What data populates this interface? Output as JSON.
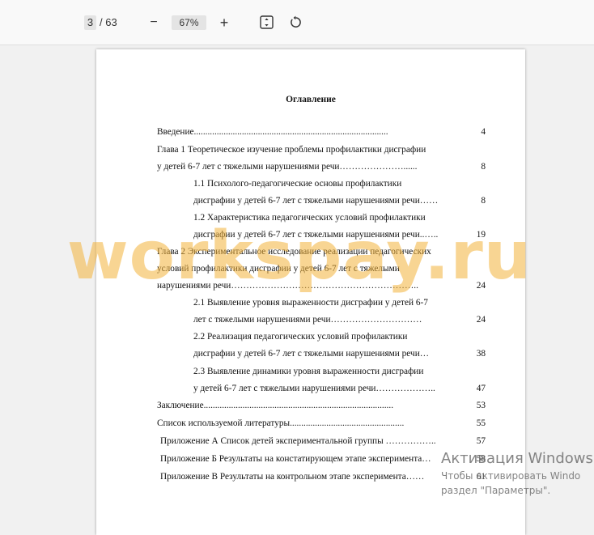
{
  "toolbar": {
    "current_page": "3",
    "total_pages": "/ 63",
    "zoom_out_label": "−",
    "zoom_level": "67%",
    "zoom_in_label": "+",
    "fit_icon": "fit-page-icon",
    "rotate_icon": "rotate-icon"
  },
  "document": {
    "title": "Оглавление",
    "toc": [
      {
        "text": "Введение.....................................................................................",
        "page": "4"
      },
      {
        "text": "Глава 1 Теоретическое изучение проблемы профилактики дисграфии",
        "page": ""
      },
      {
        "text": "у детей 6-7 лет с тяжелыми нарушениями речи…………………......",
        "page": "8"
      },
      {
        "text": "1.1 Психолого-педагогические основы профилактики",
        "page": ""
      },
      {
        "text": "дисграфии у детей 6-7 лет с тяжелыми нарушениями речи……",
        "page": "8"
      },
      {
        "text": "1.2 Характеристика педагогических условий профилактики",
        "page": ""
      },
      {
        "text": "дисграфии у детей 6-7 лет с тяжелыми нарушениями речи..…..",
        "page": "19"
      },
      {
        "text": "Глава 2 Экспериментальное исследование реализации педагогических",
        "page": ""
      },
      {
        "text": "условий профилактики дисграфии у детей 6-7 лет с тяжелыми",
        "page": ""
      },
      {
        "text": "нарушениями речи……………………………………………………..",
        "page": "24"
      },
      {
        "text": "2.1 Выявление уровня выраженности дисграфии у детей 6-7",
        "page": ""
      },
      {
        "text": "лет с тяжелыми нарушениями речи…………………………",
        "page": "24"
      },
      {
        "text": "2.2 Реализация педагогических условий профилактики",
        "page": ""
      },
      {
        "text": "дисграфии у детей 6-7 лет с тяжелыми нарушениями речи…",
        "page": "38"
      },
      {
        "text": "2.3 Выявление динамики уровня выраженности дисграфии",
        "page": ""
      },
      {
        "text": "у детей 6-7 лет с тяжелыми нарушениями речи………………..",
        "page": "47"
      },
      {
        "text": "Заключение...................................................................................",
        "page": "53"
      },
      {
        "text": "Список используемой литературы..................................................",
        "page": "55"
      },
      {
        "text": "Приложение А Список детей экспериментальной группы ……………..",
        "page": "57"
      },
      {
        "text": "Приложение Б Результаты на констатирующем этапе эксперимента…",
        "page": "58"
      },
      {
        "text": "Приложение В Результаты на контрольном этапе эксперимента……",
        "page": "61"
      }
    ]
  },
  "watermark": "workspay.ru",
  "windows_activation": {
    "title": "Активация Windows",
    "line1": "Чтобы активировать Windo",
    "line2": "раздел \"Параметры\"."
  }
}
